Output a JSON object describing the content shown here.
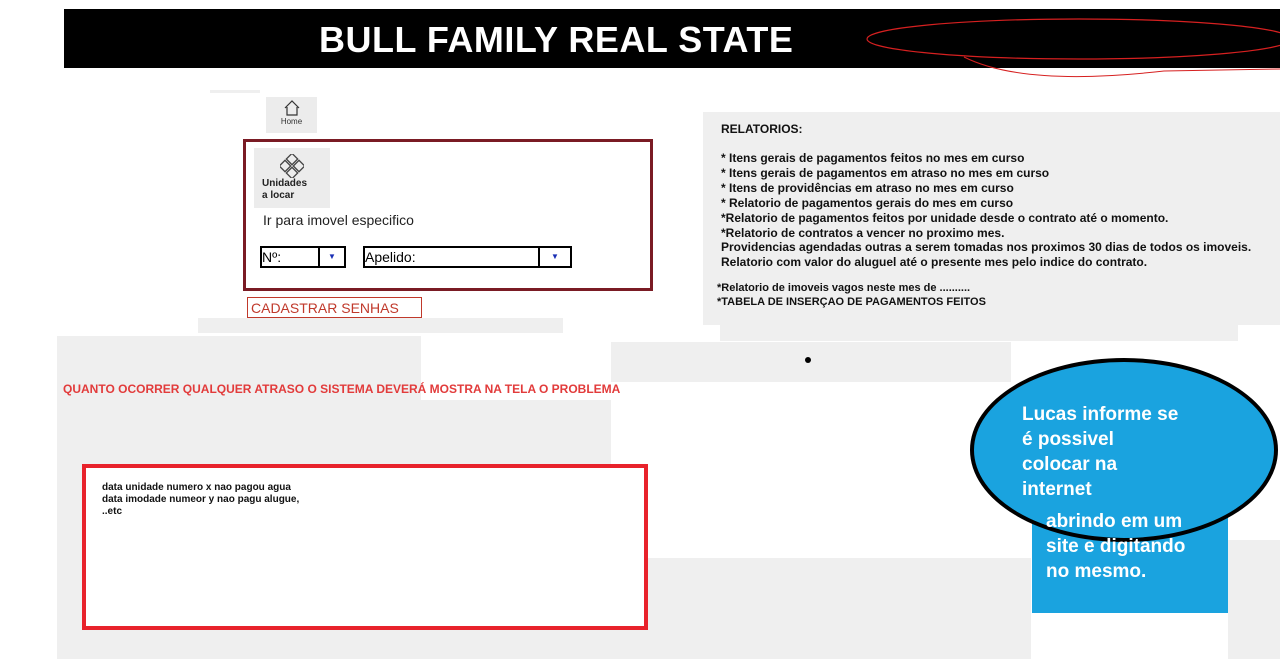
{
  "header": {
    "title": "BULL FAMILY REAL STATE"
  },
  "nav": {
    "home_label": "Home"
  },
  "panel": {
    "unidades_label_1": "Unidades",
    "unidades_label_2": "a locar",
    "goto_label": "Ir para imovel especifico",
    "numero_label": "Nº:",
    "apelido_label": "Apelido:"
  },
  "cadastrar_label": "CADASTRAR SENHAS",
  "relatorios": {
    "title": "RELATORIOS:",
    "items": [
      "* Itens gerais de pagamentos feitos no mes em curso",
      "* Itens gerais de pagamentos em atraso  no mes em curso",
      "* Itens de providências em atraso no mes em curso",
      "* Relatorio de pagamentos gerais do mes em curso",
      "*Relatorio de pagamentos feitos por unidade desde o contrato até o momento.",
      "*Relatorio de contratos a vencer no proximo mes.",
      "Providencias agendadas  outras a serem tomadas nos proximos 30 dias de todos os imoveis.",
      "Relatorio com valor do aluguel até o presente mes pelo indice do contrato."
    ],
    "extra": [
      "*Relatorio de imoveis vagos neste mes de ..........",
      "*TABELA DE INSERÇAO DE PAGAMENTOS FEITOS"
    ]
  },
  "alert_text": "QUANTO OCORRER QUALQUER ATRASO  O SISTEMA DEVERÁ MOSTRA NA TELA  O PROBLEMA",
  "alert_box": {
    "lines": [
      "data  unidade numero x nao pagou agua",
      "data imodade numeor y nao pagu alugue,",
      "..etc"
    ]
  },
  "bubble": {
    "top_lines": [
      "Lucas informe se",
      "é possivel",
      "colocar na",
      "internet"
    ],
    "bottom_lines": [
      "abrindo em um",
      "site e digitando",
      "no mesmo."
    ]
  },
  "colors": {
    "header_bg": "#000000",
    "panel_border": "#7a1b24",
    "alert_red": "#e8222b",
    "bubble_blue": "#1aa3df"
  },
  "icons": {
    "home": "home-icon",
    "unidades": "grid-diamond-icon",
    "dropdown": "chevron-down-icon"
  }
}
